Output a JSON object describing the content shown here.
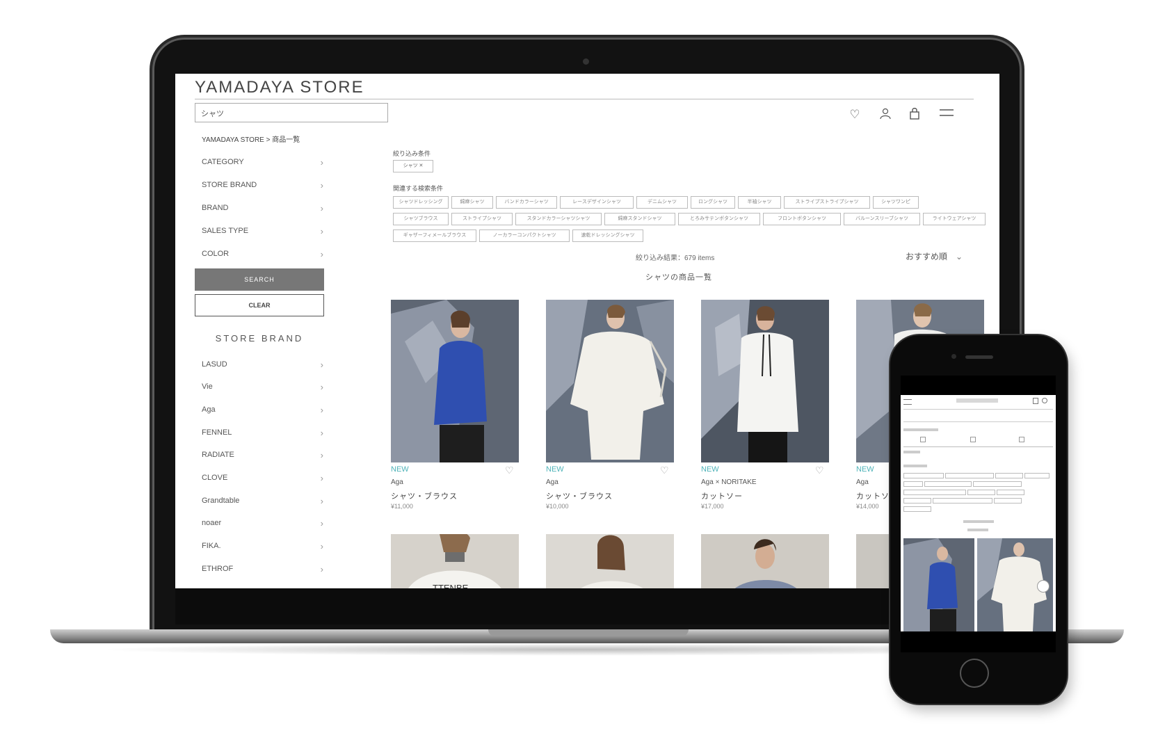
{
  "store": {
    "logo": "YAMADAYA STORE",
    "search_value": "シャツ",
    "breadcrumb": "YAMADAYA STORE > 商品一覧"
  },
  "filters": [
    {
      "label": "CATEGORY"
    },
    {
      "label": "STORE BRAND"
    },
    {
      "label": "BRAND"
    },
    {
      "label": "SALES TYPE"
    },
    {
      "label": "COLOR"
    }
  ],
  "buttons": {
    "search": "SEARCH",
    "clear": "CLEAR"
  },
  "sidebar": {
    "store_brand_heading": "STORE BRAND",
    "brands": [
      "LASUD",
      "Vie",
      "Aga",
      "FENNEL",
      "RADIATE",
      "CLOVE",
      "Grandtable",
      "noaer",
      "FIKA.",
      "ETHROF"
    ]
  },
  "refine": {
    "heading": "絞り込み条件",
    "active_tag": "シャツ ✕",
    "related_heading": "関連する検索条件",
    "related_tags": [
      "シャツドレッシング",
      "綿麻シャツ",
      "バンドカラーシャツ",
      "レースデザインシャツ",
      "デニムシャツ",
      "ロングシャツ",
      "半袖シャツ",
      "ストライプストライプシャツ",
      "シャツワンピ",
      "シャツブラウス",
      "ストライプシャツ",
      "スタンドカラーシャツシャツ",
      "綿麻スタンドシャツ",
      "とろみサテンボタンシャツ",
      "フロントボタンシャツ",
      "バルーンスリーブシャツ",
      "ライトウェアシャツ",
      "ギャザーフィメールブラウス",
      "ノーカラーコンパクトシャツ",
      "速乾ドレッシングシャツ"
    ],
    "count_text": "絞り込み結果：679 items",
    "sort": "おすすめ順"
  },
  "listing": {
    "title": "シャツの商品一覧",
    "products": [
      {
        "badge": "NEW",
        "brand": "Aga",
        "name": "シャツ・ブラウス",
        "price": "¥11,000"
      },
      {
        "badge": "NEW",
        "brand": "Aga",
        "name": "シャツ・ブラウス",
        "price": "¥10,000"
      },
      {
        "badge": "NEW",
        "brand": "Aga × NORITAKE",
        "name": "カットソー",
        "price": "¥17,000"
      },
      {
        "badge": "NEW",
        "brand": "Aga",
        "name": "カットソー",
        "price": "¥14,000"
      }
    ]
  },
  "icons": {
    "favorite": "heart-icon",
    "account": "user-icon",
    "cart": "bag-icon",
    "menu": "hamburger-icon",
    "chevron": "chevron-right-icon",
    "sort": "chevron-down-icon"
  },
  "colors": {
    "new_badge": "#4fb3b9",
    "search_button": "#777777",
    "laptop_body": "#121212"
  }
}
